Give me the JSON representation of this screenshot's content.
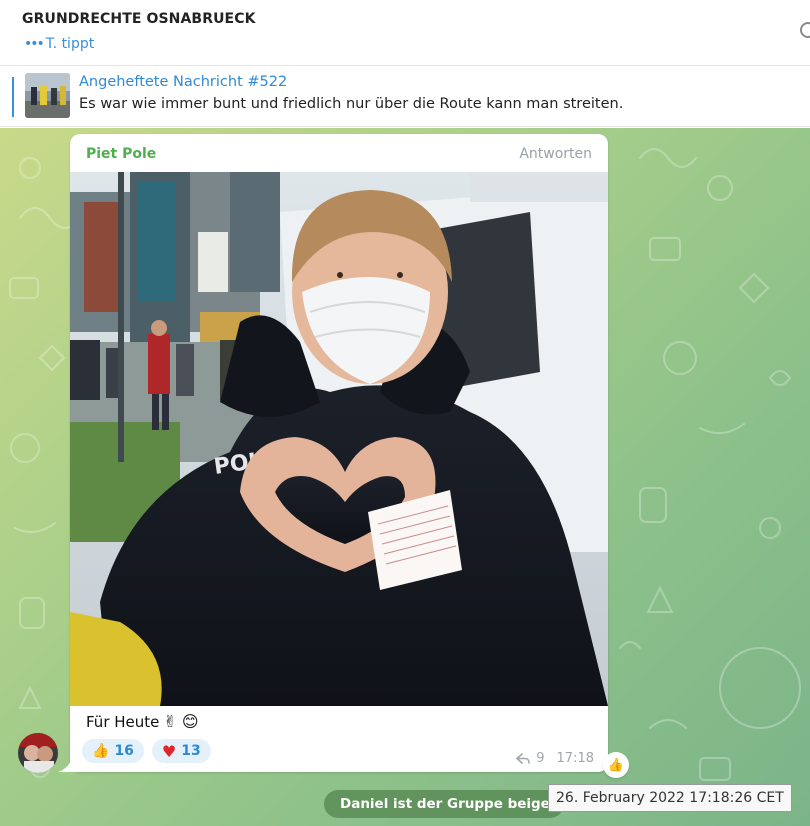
{
  "header": {
    "title": "GRUNDRECHTE OSNABRUECK",
    "typing_dots": "•••",
    "typing_text": "T. tippt"
  },
  "pinned": {
    "title": "Angeheftete Nachricht #522",
    "text": "Es war wie immer bunt und friedlich nur über die Route kann man streiten."
  },
  "message": {
    "sender": "Piet Pole",
    "reply_label": "Antworten",
    "caption": "Für Heute",
    "caption_emoji": "✌ 😊",
    "reactions": [
      {
        "emoji": "👍",
        "count": "16"
      },
      {
        "emoji": "♥",
        "count": "13"
      }
    ],
    "views": "9",
    "time": "17:18",
    "side_reaction_emoji": "👍",
    "photo_text": "POLI"
  },
  "service": {
    "text": "Daniel ist der Gruppe beigetreten"
  },
  "tooltip": {
    "text": "26. February 2022 17:18:26 CET"
  },
  "colors": {
    "accent": "#2e8ad8",
    "sender": "#4fae4e",
    "reaction_bg": "#e4f1fb"
  }
}
